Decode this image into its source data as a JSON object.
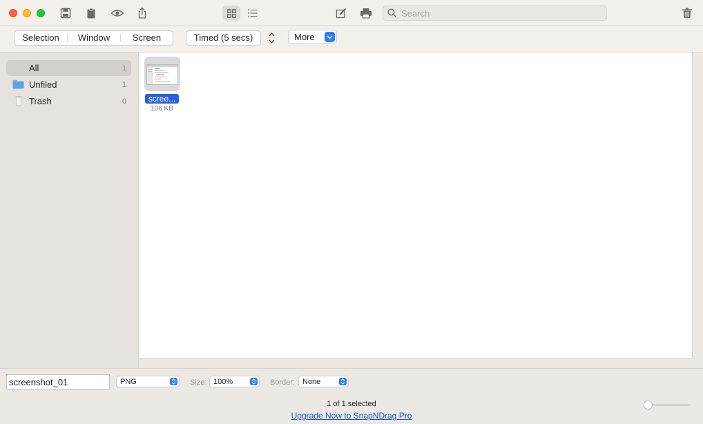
{
  "titlebar": {
    "search_placeholder": "Search"
  },
  "toolbar": {
    "segments": [
      "Selection",
      "Window",
      "Screen"
    ],
    "timed_label": "Timed (5 secs)",
    "more_label": "More"
  },
  "sidebar": {
    "items": [
      {
        "label": "All",
        "count": "1"
      },
      {
        "label": "Unfiled",
        "count": "1"
      },
      {
        "label": "Trash",
        "count": "0"
      }
    ]
  },
  "main": {
    "file": {
      "name": "scree...",
      "size": "106 KB"
    }
  },
  "bottombar": {
    "filename": "screenshot_01",
    "format": "PNG",
    "size_label": "Size:",
    "size_value": "100%",
    "border_label": "Border:",
    "border_value": "None"
  },
  "status": {
    "selection_text": "1 of 1 selected",
    "upgrade_link": "Upgrade Now to SnapNDrag Pro"
  },
  "colors": {
    "accent": "#2f7cf6",
    "selection": "#2a62d9",
    "close": "#fe5f57",
    "minimize": "#febc2e",
    "zoom": "#28c840"
  }
}
